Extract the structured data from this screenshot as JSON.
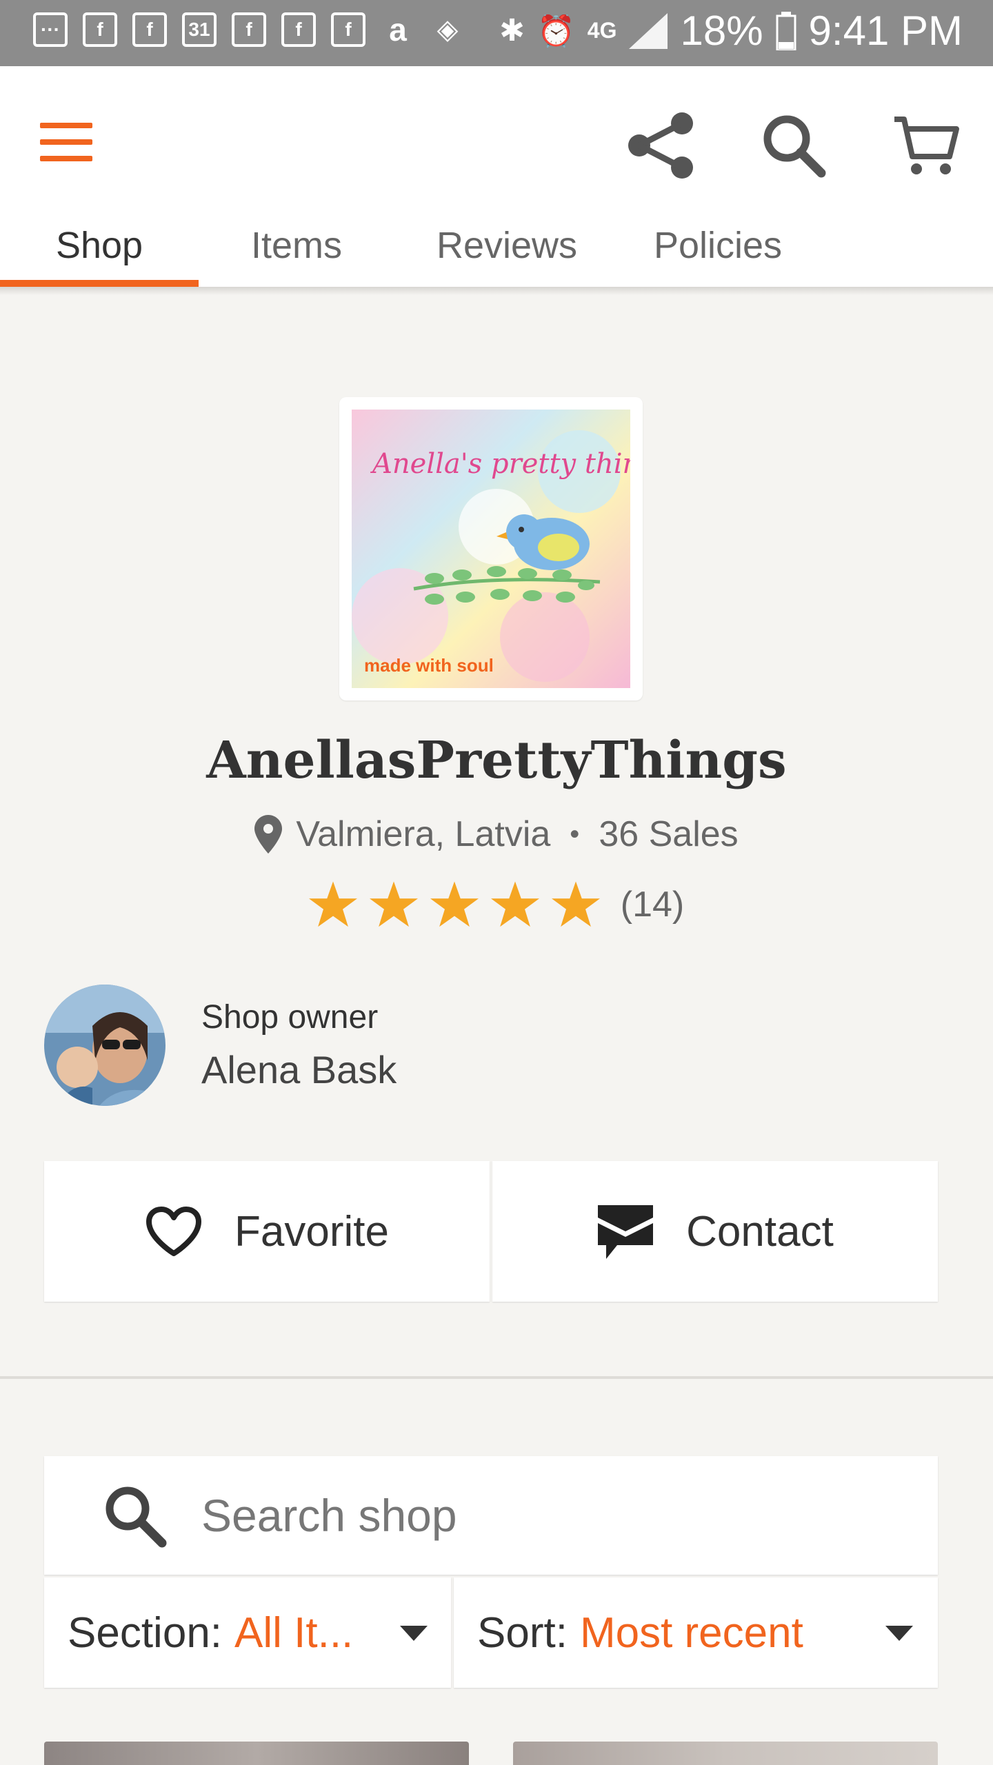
{
  "status_bar": {
    "notification_icons": [
      "messenger-icon",
      "facebook-icon",
      "facebook-icon",
      "calendar-icon",
      "facebook-icon",
      "facebook-icon",
      "facebook-icon",
      "amazon-icon",
      "dropbox-icon"
    ],
    "calendar_day": "31",
    "network": "4G",
    "battery": "18%",
    "time": "9:41 PM"
  },
  "header": {
    "actions": [
      "share-icon",
      "search-icon",
      "cart-icon"
    ]
  },
  "tabs": [
    {
      "label": "Shop",
      "active": true
    },
    {
      "label": "Items",
      "active": false
    },
    {
      "label": "Reviews",
      "active": false
    },
    {
      "label": "Policies",
      "active": false
    }
  ],
  "shop": {
    "logo_text": "Anella's pretty things",
    "logo_tagline": "made with soul",
    "name": "AnellasPrettyThings",
    "location": "Valmiera, Latvia",
    "separator": "•",
    "sales": "36 Sales",
    "rating": 5,
    "rating_count": "(14)"
  },
  "owner": {
    "label": "Shop owner",
    "name": "Alena Bask"
  },
  "buttons": {
    "favorite": "Favorite",
    "contact": "Contact"
  },
  "search": {
    "placeholder": "Search shop"
  },
  "filters": {
    "section_label": "Section:",
    "section_value": "All It...",
    "sort_label": "Sort:",
    "sort_value": "Most recent"
  },
  "colors": {
    "accent": "#f1641e",
    "star": "#f5a623",
    "status_bar": "#8c8c8c",
    "background": "#f5f4f1"
  }
}
